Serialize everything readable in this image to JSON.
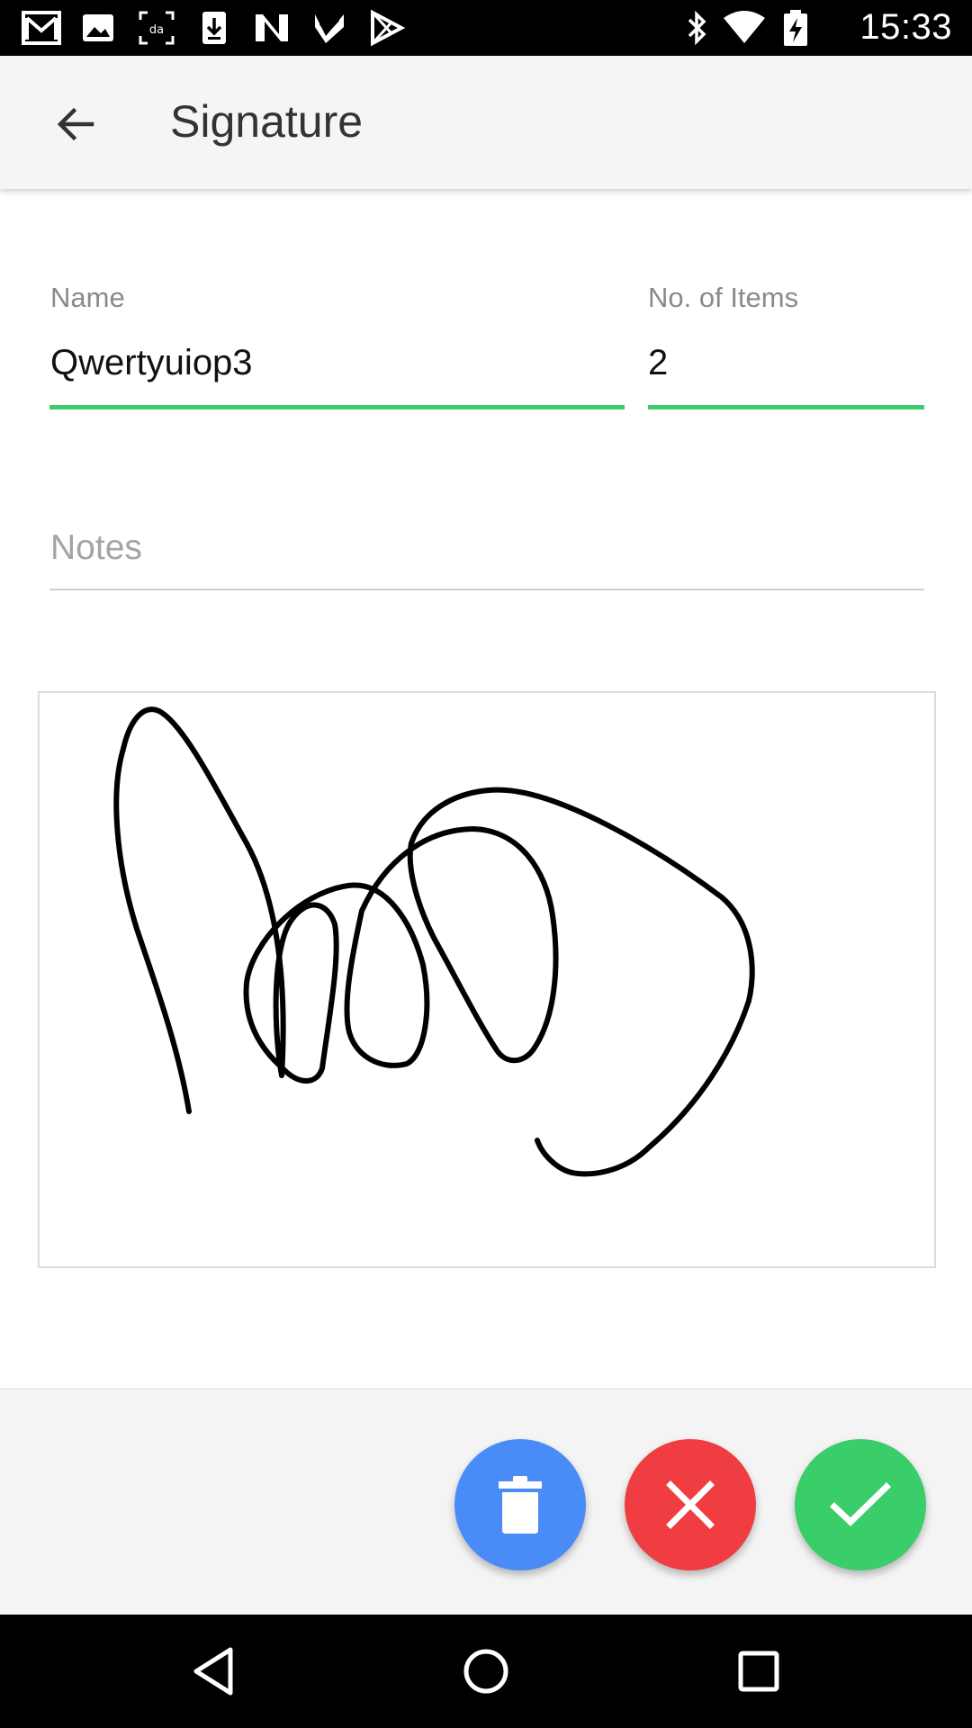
{
  "status_bar": {
    "time": "15:33",
    "left_icons": [
      "gmail-icon",
      "gallery-icon",
      "scanner-icon",
      "download-icon",
      "n-app-icon",
      "check-app-icon",
      "play-store-icon"
    ],
    "right_icons": [
      "bluetooth-icon",
      "wifi-icon",
      "battery-charging-icon"
    ]
  },
  "app_bar": {
    "title": "Signature",
    "back_icon": "arrow-back-icon"
  },
  "form": {
    "name": {
      "label": "Name",
      "value": "Qwertyuiop3"
    },
    "items": {
      "label": "No. of Items",
      "value": "2"
    },
    "notes": {
      "placeholder": "Notes",
      "value": ""
    }
  },
  "signature": {
    "has_signature": true
  },
  "actions": [
    {
      "name": "clear",
      "icon": "trash-icon",
      "color": "#4a8cf7"
    },
    {
      "name": "cancel",
      "icon": "close-icon",
      "color": "#ef3d42"
    },
    {
      "name": "confirm",
      "icon": "check-icon",
      "color": "#39ce6a"
    }
  ],
  "colors": {
    "accent_underline": "#3dcc6a",
    "status_bar": "#000000",
    "app_bar": "#f5f5f5"
  },
  "nav_bar": {
    "buttons": [
      "back-triangle-icon",
      "home-circle-icon",
      "recents-square-icon"
    ]
  }
}
